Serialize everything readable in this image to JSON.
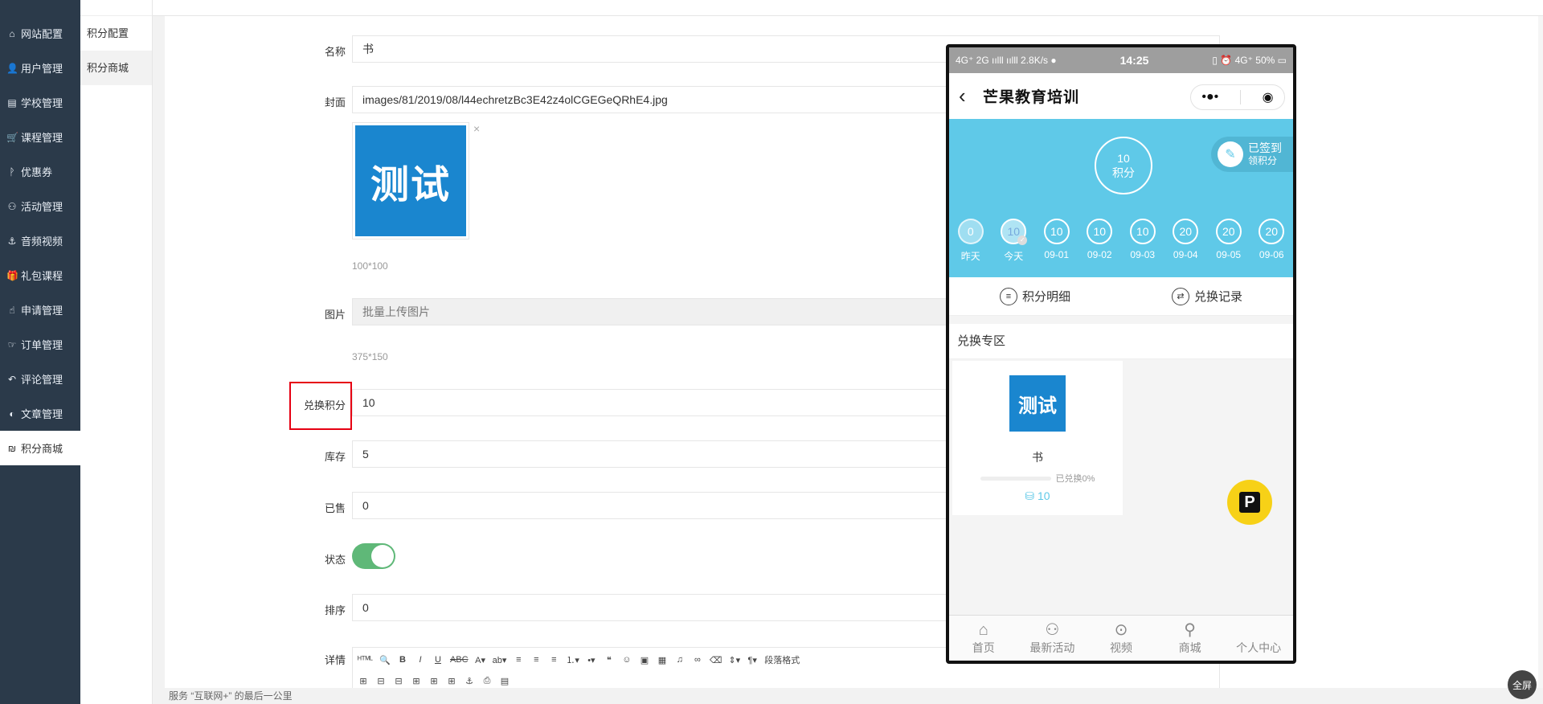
{
  "nav": {
    "items": [
      {
        "label": "网站配置",
        "icon": "⌂"
      },
      {
        "label": "用户管理",
        "icon": "👤"
      },
      {
        "label": "学校管理",
        "icon": "▤"
      },
      {
        "label": "课程管理",
        "icon": "🛒"
      },
      {
        "label": "优惠券",
        "icon": "ᚹ"
      },
      {
        "label": "活动管理",
        "icon": "⚇"
      },
      {
        "label": "音频视频",
        "icon": "⚓"
      },
      {
        "label": "礼包课程",
        "icon": "🎁"
      },
      {
        "label": "申请管理",
        "icon": "☝"
      },
      {
        "label": "订单管理",
        "icon": "☞"
      },
      {
        "label": "评论管理",
        "icon": "↶"
      },
      {
        "label": "文章管理",
        "icon": "◐"
      },
      {
        "label": "积分商城",
        "icon": "₪"
      }
    ]
  },
  "subnav": {
    "items": [
      {
        "label": "积分配置"
      },
      {
        "label": "积分商城"
      }
    ]
  },
  "form": {
    "name_label": "名称",
    "name_value": "书",
    "cover_label": "封面",
    "cover_value": "images/81/2019/08/l44echretzBc3E42z4olCGEGeQRhE4.jpg",
    "cover_thumb_text": "测试",
    "cover_close": "×",
    "cover_hint": "100*100",
    "image_label": "图片",
    "image_placeholder": "批量上传图片",
    "image_hint": "375*150",
    "exchange_label": "兑换积分",
    "exchange_value": "10",
    "stock_label": "库存",
    "stock_value": "5",
    "sold_label": "已售",
    "sold_value": "0",
    "status_label": "状态",
    "sort_label": "排序",
    "sort_value": "0",
    "detail_label": "详情",
    "editor_paragraph": "段落格式"
  },
  "footer_text": "服务 “互联网+” 的最后一公里",
  "phone": {
    "status": {
      "left": "4G⁺ 2G ıılll ıılll 2.8K/s ●",
      "time": "14:25",
      "right": "▯ ⏰ 4G⁺ 50% ▭"
    },
    "title": "芒果教育培训",
    "back": "‹",
    "capsule_more": "•●•",
    "capsule_target": "◉",
    "points_value": "10",
    "points_unit": "积分",
    "signed_title": "已签到",
    "signed_sub": "领积分",
    "signed_icon": "✎",
    "days": [
      {
        "value": "0",
        "label": "昨天"
      },
      {
        "value": "10",
        "label": "今天"
      },
      {
        "value": "10",
        "label": "09-01"
      },
      {
        "value": "10",
        "label": "09-02"
      },
      {
        "value": "10",
        "label": "09-03"
      },
      {
        "value": "20",
        "label": "09-04"
      },
      {
        "value": "20",
        "label": "09-05"
      },
      {
        "value": "20",
        "label": "09-06"
      }
    ],
    "actions": {
      "detail": "积分明细",
      "record": "兑换记录",
      "detail_icon": "≡",
      "record_icon": "⇄"
    },
    "section_title": "兑换专区",
    "product": {
      "image_text": "测试",
      "name": "书",
      "exchanged": "已兑换0%",
      "points": "10",
      "points_icon": "⛁"
    },
    "badge": "P",
    "tabs": [
      {
        "label": "首页",
        "icon": "⌂"
      },
      {
        "label": "最新活动",
        "icon": "⚇"
      },
      {
        "label": "视频",
        "icon": "⊙"
      },
      {
        "label": "商城",
        "icon": "⚲"
      },
      {
        "label": "个人中心",
        "icon": ""
      }
    ]
  },
  "fullscreen_label": "全屏",
  "colors": {
    "nav_bg": "#2b3a4a",
    "accent": "#5fc9e8",
    "toggle_on": "#5fb878",
    "highlight": "#e60012",
    "thumb": "#1a86cf"
  }
}
